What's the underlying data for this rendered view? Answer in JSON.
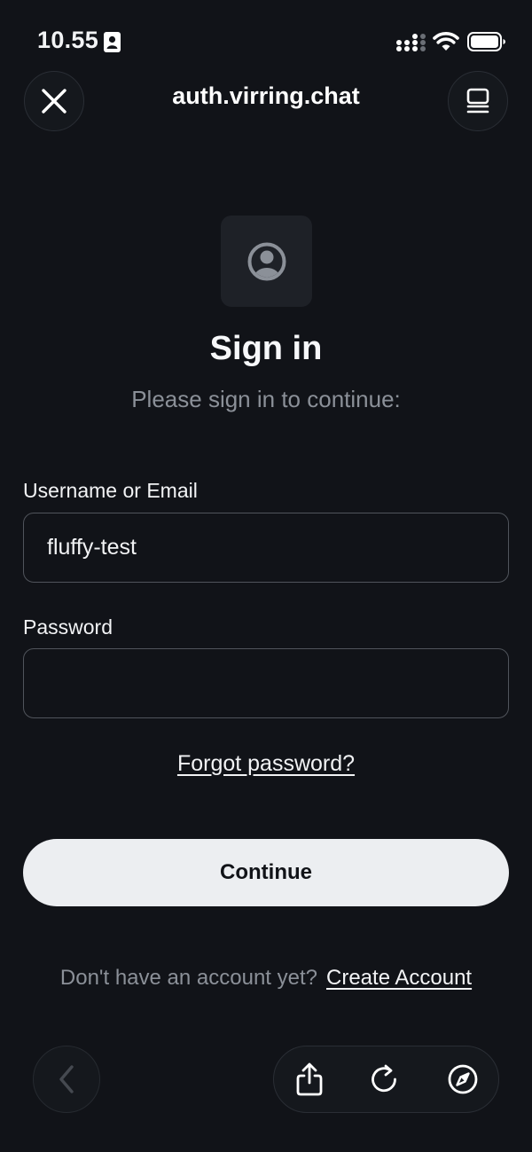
{
  "status_bar": {
    "time": "10.55"
  },
  "browser": {
    "url": "auth.virring.chat"
  },
  "form": {
    "heading": "Sign in",
    "subheading": "Please sign in to continue:",
    "username_label": "Username or Email",
    "username_value": "fluffy-test",
    "password_label": "Password",
    "password_value": "",
    "forgot_password": "Forgot password?",
    "continue_label": "Continue",
    "signup_prompt": "Don't have an account yet?",
    "create_account": "Create Account"
  },
  "icons": {
    "close": "close-icon",
    "tabs": "tabs-icon",
    "avatar": "user-circle-icon",
    "back": "chevron-left-icon",
    "share": "share-icon",
    "reload": "reload-icon",
    "compass": "compass-icon"
  },
  "colors": {
    "background": "#111318",
    "text_primary": "#f2f3f5",
    "text_secondary": "#8b9098",
    "button_fill": "#eceef1",
    "field_border": "#50545b"
  }
}
